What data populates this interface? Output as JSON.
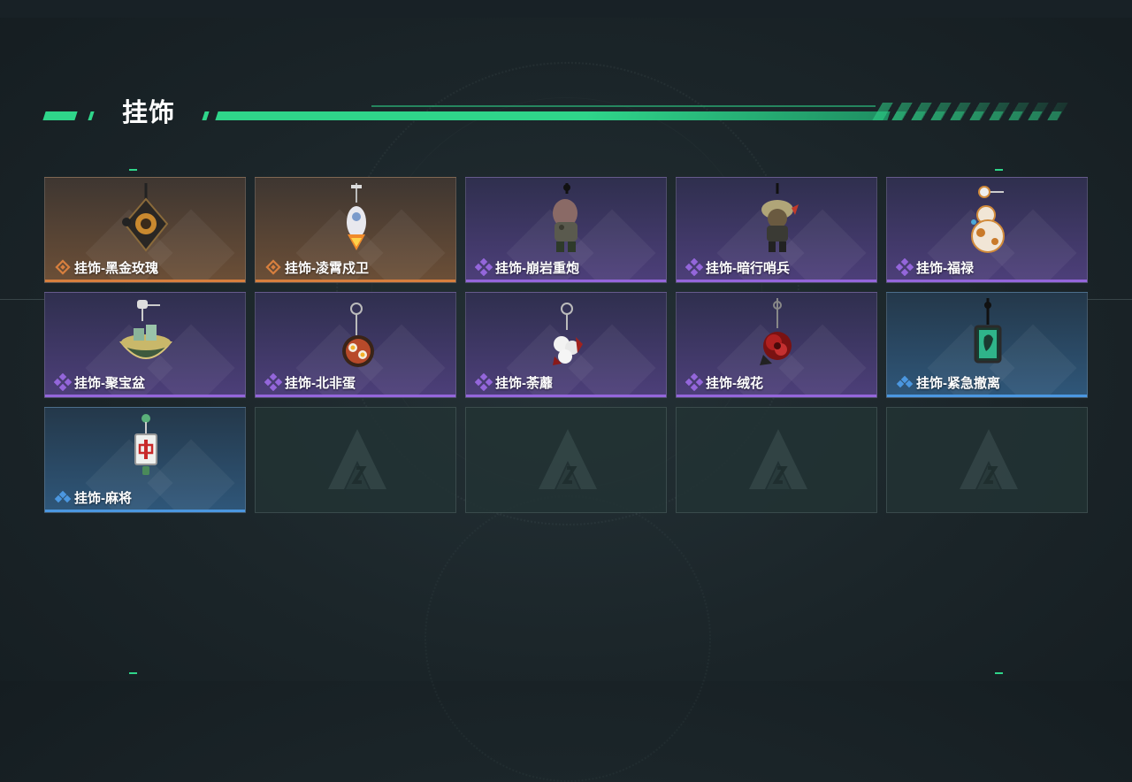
{
  "page": {
    "title": "挂饰"
  },
  "colors": {
    "accent": "#2fd58a",
    "rarity_orange": "#d77f3e",
    "rarity_purple": "#9466db",
    "rarity_blue": "#4b97e0"
  },
  "items": [
    {
      "name": "挂饰-黑金玫瑰",
      "rarity": "orange",
      "icon": "black-gold-rose-charm"
    },
    {
      "name": "挂饰-凌霄戍卫",
      "rarity": "orange",
      "icon": "rocket-guard-charm"
    },
    {
      "name": "挂饰-崩岩重炮",
      "rarity": "purple",
      "icon": "heavy-cannon-charm"
    },
    {
      "name": "挂饰-暗行哨兵",
      "rarity": "purple",
      "icon": "shadow-sentry-charm"
    },
    {
      "name": "挂饰-福禄",
      "rarity": "purple",
      "icon": "gourd-charm"
    },
    {
      "name": "挂饰-聚宝盆",
      "rarity": "purple",
      "icon": "treasure-bowl-charm"
    },
    {
      "name": "挂饰-北非蛋",
      "rarity": "purple",
      "icon": "shakshuka-charm"
    },
    {
      "name": "挂饰-荼蘼",
      "rarity": "purple",
      "icon": "white-flower-charm"
    },
    {
      "name": "挂饰-绒花",
      "rarity": "purple",
      "icon": "velvet-flower-charm"
    },
    {
      "name": "挂饰-紧急撤离",
      "rarity": "blue",
      "icon": "emergency-evac-charm"
    },
    {
      "name": "挂饰-麻将",
      "rarity": "blue",
      "icon": "mahjong-charm"
    },
    {
      "name": "",
      "rarity": "empty",
      "icon": "empty-slot-logo"
    },
    {
      "name": "",
      "rarity": "empty",
      "icon": "empty-slot-logo"
    },
    {
      "name": "",
      "rarity": "empty",
      "icon": "empty-slot-logo"
    },
    {
      "name": "",
      "rarity": "empty",
      "icon": "empty-slot-logo"
    }
  ]
}
